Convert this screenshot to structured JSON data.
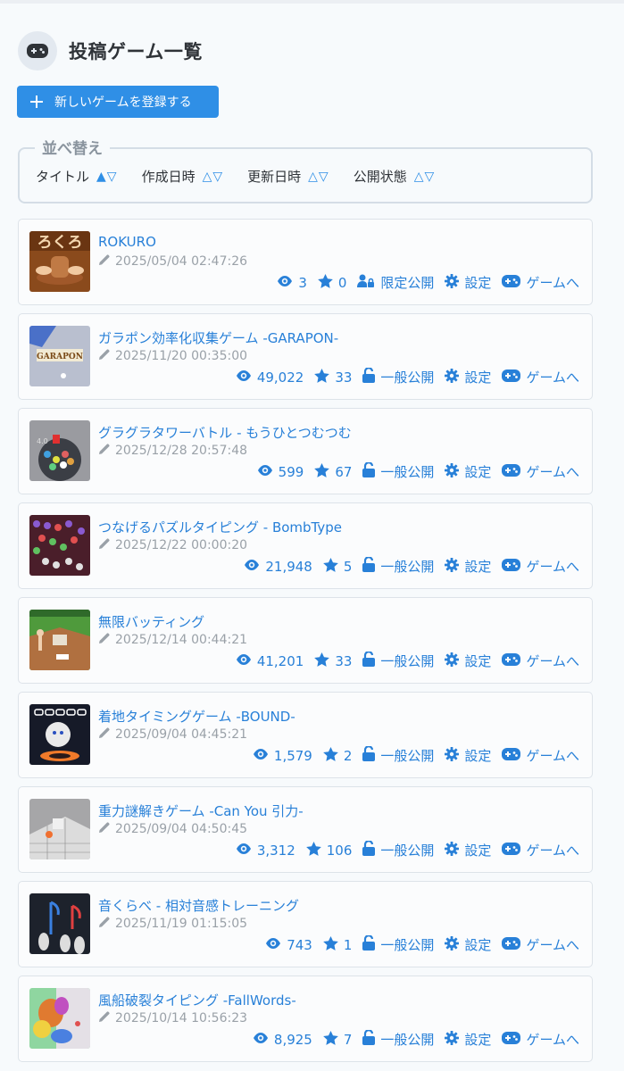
{
  "page": {
    "title": "投稿ゲーム一覧"
  },
  "add_button": {
    "label": "新しいゲームを登録する"
  },
  "sort": {
    "legend": "並べ替え",
    "items": [
      {
        "label": "タイトル",
        "arrows": "▲▽"
      },
      {
        "label": "作成日時",
        "arrows": "△▽"
      },
      {
        "label": "更新日時",
        "arrows": "△▽"
      },
      {
        "label": "公開状態",
        "arrows": "△▽"
      }
    ]
  },
  "colors": {
    "accent": "#2f8fe6",
    "link": "#2880d8",
    "muted": "#9aa1a8"
  },
  "games": [
    {
      "title": "ROKURO",
      "date": "2025/05/04 02:47:26",
      "views": "3",
      "stars": "0",
      "visibility": "限定公開",
      "visibility_icon": "user-lock-icon",
      "settings": "設定",
      "play": "ゲームへ"
    },
    {
      "title": "ガラポン効率化収集ゲーム -GARAPON-",
      "date": "2025/11/20 00:35:00",
      "views": "49,022",
      "stars": "33",
      "visibility": "一般公開",
      "visibility_icon": "unlock-icon",
      "settings": "設定",
      "play": "ゲームへ"
    },
    {
      "title": "グラグラタワーバトル - もうひとつむつむ",
      "date": "2025/12/28 20:57:48",
      "views": "599",
      "stars": "67",
      "visibility": "一般公開",
      "visibility_icon": "unlock-icon",
      "settings": "設定",
      "play": "ゲームへ"
    },
    {
      "title": "つなげるパズルタイピング - BombType",
      "date": "2025/12/22 00:00:20",
      "views": "21,948",
      "stars": "5",
      "visibility": "一般公開",
      "visibility_icon": "unlock-icon",
      "settings": "設定",
      "play": "ゲームへ"
    },
    {
      "title": "無限バッティング",
      "date": "2025/12/14 00:44:21",
      "views": "41,201",
      "stars": "33",
      "visibility": "一般公開",
      "visibility_icon": "unlock-icon",
      "settings": "設定",
      "play": "ゲームへ"
    },
    {
      "title": "着地タイミングゲーム -BOUND-",
      "date": "2025/09/04 04:45:21",
      "views": "1,579",
      "stars": "2",
      "visibility": "一般公開",
      "visibility_icon": "unlock-icon",
      "settings": "設定",
      "play": "ゲームへ"
    },
    {
      "title": "重力謎解きゲーム -Can You 引力-",
      "date": "2025/09/04 04:50:45",
      "views": "3,312",
      "stars": "106",
      "visibility": "一般公開",
      "visibility_icon": "unlock-icon",
      "settings": "設定",
      "play": "ゲームへ"
    },
    {
      "title": "音くらべ - 相対音感トレーニング",
      "date": "2025/11/19 01:15:05",
      "views": "743",
      "stars": "1",
      "visibility": "一般公開",
      "visibility_icon": "unlock-icon",
      "settings": "設定",
      "play": "ゲームへ"
    },
    {
      "title": "風船破裂タイピング -FallWords-",
      "date": "2025/10/14 10:56:23",
      "views": "8,925",
      "stars": "7",
      "visibility": "一般公開",
      "visibility_icon": "unlock-icon",
      "settings": "設定",
      "play": "ゲームへ"
    }
  ]
}
